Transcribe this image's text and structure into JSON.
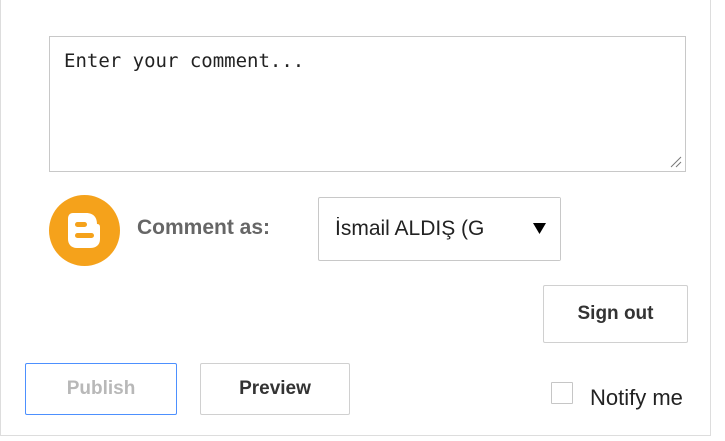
{
  "comment_form": {
    "comment_input": {
      "value": "",
      "placeholder": "Enter your comment..."
    },
    "avatar_icon": "blogger-logo-icon",
    "comment_as_label": "Comment as:",
    "identity_select": {
      "selected": "İsmail ALDIŞ (G"
    },
    "sign_out_label": "Sign out",
    "publish_label": "Publish",
    "preview_label": "Preview",
    "notify_label": "Notify me",
    "notify_checked": false,
    "colors": {
      "blogger_orange": "#f5a21b",
      "publish_border": "#4d90fe"
    }
  }
}
